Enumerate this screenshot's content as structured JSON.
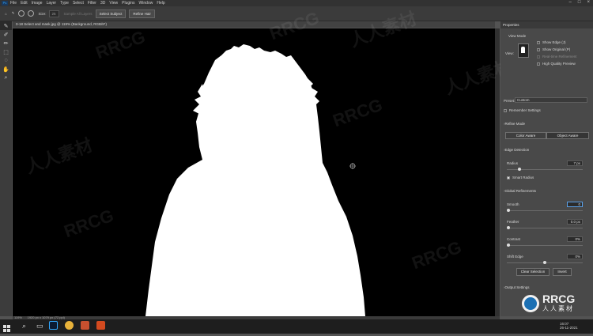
{
  "menu": {
    "logo": "Ps",
    "items": [
      "File",
      "Edit",
      "Image",
      "Layer",
      "Type",
      "Select",
      "Filter",
      "3D",
      "View",
      "Plugins",
      "Window",
      "Help"
    ],
    "window_controls": [
      "–",
      "□",
      "×"
    ]
  },
  "options": {
    "size_label": "Size:",
    "size_value": "25",
    "sample_all": "Sample All Layers",
    "select_subject": "Select Subject",
    "refine_hair": "Refine Hair"
  },
  "document": {
    "tab_title": "0-18 Select and mask.jpg @ 119% (Background, RGB/8*)"
  },
  "tools": [
    "quick-selection",
    "refine-edge-brush",
    "brush",
    "object-selection",
    "lasso",
    "hand",
    "zoom"
  ],
  "properties": {
    "tab": "Properties",
    "view_mode_label": "View Mode",
    "view_label": "View:",
    "show_edge": "Show Edge (J)",
    "show_original": "Show Original (P)",
    "realtime_refinement": "Real-time Refinement",
    "high_quality_preview": "High Quality Preview",
    "preset_label": "Preset:",
    "preset_value": "Custom",
    "remember_settings": "Remember Settings",
    "refine_mode": "Refine Mode",
    "color_aware": "Color Aware",
    "object_aware": "Object Aware",
    "edge_detection": "Edge Detection",
    "radius_label": "Radius",
    "radius_value": "7 px",
    "smart_radius": "Smart Radius",
    "global_refinements": "Global Refinements",
    "smooth_label": "Smooth",
    "smooth_value": "0",
    "feather_label": "Feather",
    "feather_value": "0.0 px",
    "contrast_label": "Contrast",
    "contrast_value": "0%",
    "shift_edge_label": "Shift Edge",
    "shift_edge_value": "0%",
    "clear_selection": "Clear Selection",
    "invert": "Invert",
    "output_settings": "Output Settings"
  },
  "status": {
    "zoom": "119%",
    "doc_info": "1920 px x 1079 px (72 ppi)"
  },
  "taskbar": {
    "time": "16:07",
    "date": "26-11-2021"
  },
  "watermarks": [
    "RRCG",
    "人人素材"
  ],
  "logo": {
    "title": "RRCG",
    "subtitle": "人人素材"
  },
  "colors": {
    "accent": "#31a8ff",
    "photoshop_taskbar": "#0b1b33",
    "chrome_taskbar": "#e8b23a",
    "app_red": "#c8502f",
    "app_orange": "#d34a1f"
  }
}
